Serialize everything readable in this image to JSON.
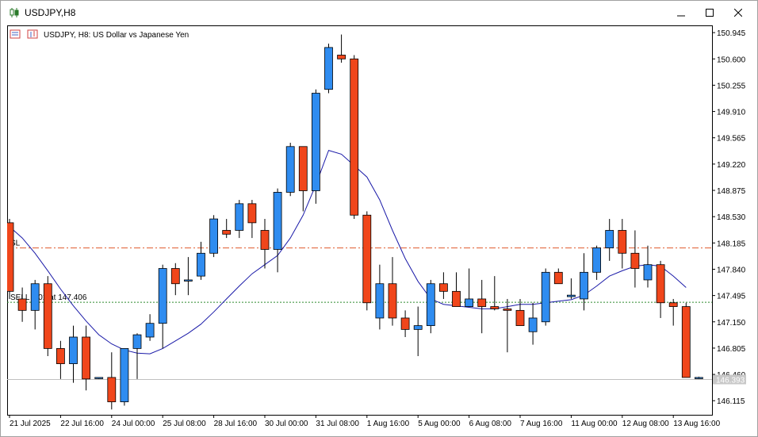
{
  "window": {
    "title": "USDJPY,H8"
  },
  "chart_header": {
    "text": "USDJPY, H8:  US Dollar vs Japanese Yen"
  },
  "colors": {
    "bull": "#2f8cf0",
    "bear": "#f0461b",
    "wick": "#000000",
    "ma": "#1a1aa8",
    "sl_line": "#e05a2e",
    "entry_line": "#2e8b2e",
    "bid_line": "#c0c0c0"
  },
  "chart_data": {
    "type": "candlestick",
    "symbol": "USDJPY",
    "timeframe": "H8",
    "ylim": [
      145.93,
      151.04
    ],
    "y_ticks": [
      "150.945",
      "150.600",
      "150.255",
      "149.910",
      "149.565",
      "149.220",
      "148.875",
      "148.530",
      "148.185",
      "147.840",
      "147.495",
      "147.150",
      "146.805",
      "146.460",
      "146.115"
    ],
    "x_ticks": [
      "21 Jul 2025",
      "22 Jul 16:00",
      "24 Jul 00:00",
      "25 Jul 08:00",
      "28 Jul 16:00",
      "30 Jul 00:00",
      "31 Jul 08:00",
      "1 Aug 16:00",
      "5 Aug 00:00",
      "6 Aug 08:00",
      "7 Aug 16:00",
      "11 Aug 00:00",
      "12 Aug 08:00",
      "13 Aug 16:00"
    ],
    "x_tick_index": [
      0,
      4,
      8,
      12,
      16,
      20,
      24,
      28,
      32,
      36,
      40,
      44,
      48,
      52
    ],
    "candles": [
      {
        "o": 148.45,
        "h": 148.5,
        "l": 147.45,
        "c": 147.55
      },
      {
        "o": 147.45,
        "h": 147.6,
        "l": 147.15,
        "c": 147.3
      },
      {
        "o": 147.3,
        "h": 147.7,
        "l": 147.05,
        "c": 147.65
      },
      {
        "o": 147.65,
        "h": 147.75,
        "l": 146.7,
        "c": 146.8
      },
      {
        "o": 146.8,
        "h": 146.9,
        "l": 146.4,
        "c": 146.6
      },
      {
        "o": 146.6,
        "h": 147.1,
        "l": 146.35,
        "c": 146.95
      },
      {
        "o": 146.95,
        "h": 147.1,
        "l": 146.25,
        "c": 146.4
      },
      {
        "o": 146.41,
        "h": 146.42,
        "l": 146.4,
        "c": 146.42
      },
      {
        "o": 146.42,
        "h": 146.75,
        "l": 146.0,
        "c": 146.1
      },
      {
        "o": 146.1,
        "h": 146.8,
        "l": 146.05,
        "c": 146.8
      },
      {
        "o": 146.8,
        "h": 147.0,
        "l": 146.4,
        "c": 146.98
      },
      {
        "o": 146.95,
        "h": 147.25,
        "l": 146.9,
        "c": 147.13
      },
      {
        "o": 147.13,
        "h": 147.9,
        "l": 146.8,
        "c": 147.85
      },
      {
        "o": 147.85,
        "h": 147.92,
        "l": 147.5,
        "c": 147.65
      },
      {
        "o": 147.7,
        "h": 148.0,
        "l": 147.5,
        "c": 147.7
      },
      {
        "o": 147.75,
        "h": 148.2,
        "l": 147.7,
        "c": 148.05
      },
      {
        "o": 148.05,
        "h": 148.55,
        "l": 148.0,
        "c": 148.5
      },
      {
        "o": 148.35,
        "h": 148.5,
        "l": 148.25,
        "c": 148.3
      },
      {
        "o": 148.35,
        "h": 148.75,
        "l": 148.25,
        "c": 148.7
      },
      {
        "o": 148.7,
        "h": 148.75,
        "l": 148.25,
        "c": 148.45
      },
      {
        "o": 148.35,
        "h": 148.5,
        "l": 147.85,
        "c": 148.1
      },
      {
        "o": 148.1,
        "h": 148.9,
        "l": 147.8,
        "c": 148.85
      },
      {
        "o": 148.85,
        "h": 149.5,
        "l": 148.8,
        "c": 149.45
      },
      {
        "o": 149.45,
        "h": 149.45,
        "l": 148.6,
        "c": 148.87
      },
      {
        "o": 148.87,
        "h": 150.2,
        "l": 148.7,
        "c": 150.15
      },
      {
        "o": 150.2,
        "h": 150.8,
        "l": 150.15,
        "c": 150.75
      },
      {
        "o": 150.65,
        "h": 150.92,
        "l": 150.55,
        "c": 150.6
      },
      {
        "o": 150.6,
        "h": 150.65,
        "l": 148.5,
        "c": 148.55
      },
      {
        "o": 148.55,
        "h": 148.6,
        "l": 147.3,
        "c": 147.4
      },
      {
        "o": 147.2,
        "h": 147.9,
        "l": 147.05,
        "c": 147.65
      },
      {
        "o": 147.65,
        "h": 148.0,
        "l": 147.1,
        "c": 147.2
      },
      {
        "o": 147.2,
        "h": 147.3,
        "l": 146.95,
        "c": 147.05
      },
      {
        "o": 147.05,
        "h": 147.35,
        "l": 146.7,
        "c": 147.1
      },
      {
        "o": 147.1,
        "h": 147.7,
        "l": 147.0,
        "c": 147.65
      },
      {
        "o": 147.65,
        "h": 147.8,
        "l": 147.45,
        "c": 147.55
      },
      {
        "o": 147.55,
        "h": 147.8,
        "l": 147.35,
        "c": 147.35
      },
      {
        "o": 147.35,
        "h": 147.85,
        "l": 147.35,
        "c": 147.45
      },
      {
        "o": 147.45,
        "h": 147.7,
        "l": 147.0,
        "c": 147.35
      },
      {
        "o": 147.35,
        "h": 147.75,
        "l": 147.3,
        "c": 147.32
      },
      {
        "o": 147.32,
        "h": 147.45,
        "l": 146.75,
        "c": 147.3
      },
      {
        "o": 147.3,
        "h": 147.45,
        "l": 147.1,
        "c": 147.1
      },
      {
        "o": 147.02,
        "h": 147.4,
        "l": 146.85,
        "c": 147.2
      },
      {
        "o": 147.15,
        "h": 147.85,
        "l": 147.1,
        "c": 147.8
      },
      {
        "o": 147.8,
        "h": 147.85,
        "l": 147.65,
        "c": 147.65
      },
      {
        "o": 147.48,
        "h": 147.72,
        "l": 147.45,
        "c": 147.5
      },
      {
        "o": 147.45,
        "h": 148.05,
        "l": 147.3,
        "c": 147.8
      },
      {
        "o": 147.8,
        "h": 148.15,
        "l": 147.7,
        "c": 148.12
      },
      {
        "o": 148.12,
        "h": 148.5,
        "l": 147.95,
        "c": 148.35
      },
      {
        "o": 148.35,
        "h": 148.5,
        "l": 147.85,
        "c": 148.05
      },
      {
        "o": 148.05,
        "h": 148.35,
        "l": 147.6,
        "c": 147.85
      },
      {
        "o": 147.7,
        "h": 148.15,
        "l": 147.6,
        "c": 147.9
      },
      {
        "o": 147.9,
        "h": 147.95,
        "l": 147.2,
        "c": 147.4
      },
      {
        "o": 147.4,
        "h": 147.45,
        "l": 147.1,
        "c": 147.35
      },
      {
        "o": 147.35,
        "h": 147.4,
        "l": 146.42,
        "c": 146.42
      },
      {
        "o": 146.42,
        "h": 146.43,
        "l": 146.4,
        "c": 146.42
      }
    ],
    "moving_average": [
      148.4,
      148.25,
      148.05,
      147.82,
      147.58,
      147.36,
      147.16,
      146.98,
      146.86,
      146.78,
      146.74,
      146.73,
      146.8,
      146.9,
      147.0,
      147.12,
      147.28,
      147.45,
      147.62,
      147.78,
      147.9,
      148.02,
      148.25,
      148.55,
      148.95,
      149.4,
      149.35,
      149.2,
      149.05,
      148.75,
      148.35,
      147.98,
      147.68,
      147.45,
      147.38,
      147.36,
      147.34,
      147.32,
      147.32,
      147.35,
      147.38,
      147.38,
      147.4,
      147.42,
      147.44,
      147.5,
      147.62,
      147.75,
      147.82,
      147.88,
      147.9,
      147.88,
      147.75,
      147.6
    ],
    "levels": {
      "sl": {
        "price": 148.12,
        "label": "SL"
      },
      "entry": {
        "price": 147.406,
        "label": "SELL 0.01 at 147.406"
      },
      "bid": {
        "price": 146.393,
        "label": "146.393"
      }
    }
  }
}
